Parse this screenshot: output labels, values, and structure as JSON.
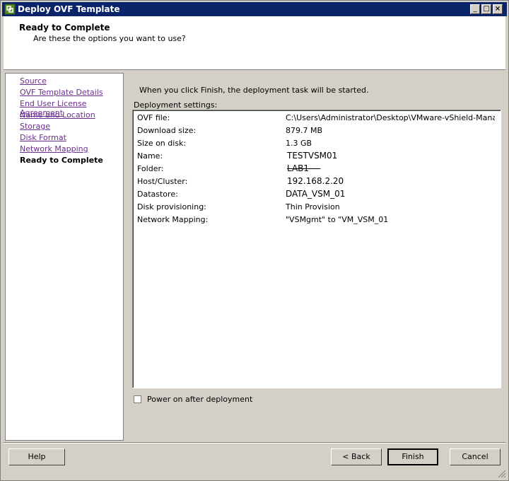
{
  "window": {
    "title": "Deploy OVF Template",
    "minimize": "_",
    "maximize": "□",
    "close": "×"
  },
  "header": {
    "title": "Ready to Complete",
    "subtitle": "Are these the options you want to use?"
  },
  "nav": {
    "items": [
      {
        "label": "Source"
      },
      {
        "label": "OVF Template Details"
      },
      {
        "label": "End User License Agreement"
      },
      {
        "label": "Name and Location"
      },
      {
        "label": "Storage"
      },
      {
        "label": "Disk Format"
      },
      {
        "label": "Network Mapping"
      },
      {
        "label": "Ready to Complete"
      }
    ]
  },
  "main": {
    "intro": "When you click Finish, the deployment task will be started.",
    "settings_label": "Deployment settings:",
    "settings": [
      {
        "key": "OVF file:",
        "value": "C:\\Users\\Administrator\\Desktop\\VMware-vShield-Manager..."
      },
      {
        "key": "Download size:",
        "value": "879.7 MB"
      },
      {
        "key": "Size on disk:",
        "value": "1.3 GB"
      },
      {
        "key": "Name:",
        "value": "TESTVSM01"
      },
      {
        "key": "Folder:",
        "value": "LAB1 - -"
      },
      {
        "key": "Host/Cluster:",
        "value": "192.168.2.20"
      },
      {
        "key": "Datastore:",
        "value": "DATA_VSM_01"
      },
      {
        "key": "Disk provisioning:",
        "value": "Thin Provision"
      },
      {
        "key": "Network Mapping:",
        "value": "\"VSMgmt\" to \"VM_VSM_01"
      }
    ],
    "power_on_label": "Power on after deployment"
  },
  "buttons": {
    "help": "Help",
    "back": "< Back",
    "finish": "Finish",
    "cancel": "Cancel"
  },
  "colors": {
    "titlebar": "#0a246a",
    "visited_link": "#6b2f8f",
    "dialog_bg": "#d4d0c8"
  }
}
